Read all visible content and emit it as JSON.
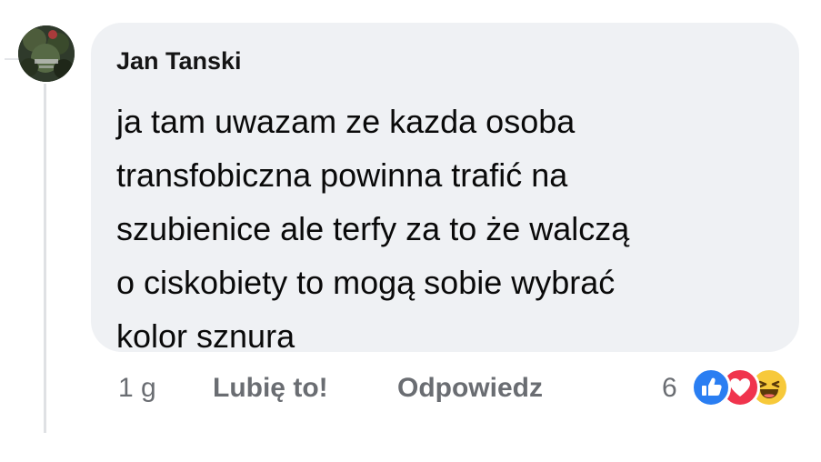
{
  "comment": {
    "author": "Jan Tanski",
    "lines": [
      "ja tam uwazam ze kazda osoba",
      "transfobiczna powinna trafić na",
      "szubienice ale terfy za to że walczą",
      "o ciskobiety to mogą sobie wybrać",
      "kolor sznura"
    ]
  },
  "actions": {
    "time": "1 g",
    "like_label": "Lubię to!",
    "reply_label": "Odpowiedz"
  },
  "reactions": {
    "count": "6",
    "icons": [
      "like-icon",
      "love-icon",
      "haha-icon"
    ],
    "colors": {
      "like": "#2a7ef2",
      "love": "#f0344d",
      "haha": "#f7c93a"
    }
  },
  "colors": {
    "bubble_bg": "#eff1f4",
    "meta_text": "#6a6d72"
  }
}
